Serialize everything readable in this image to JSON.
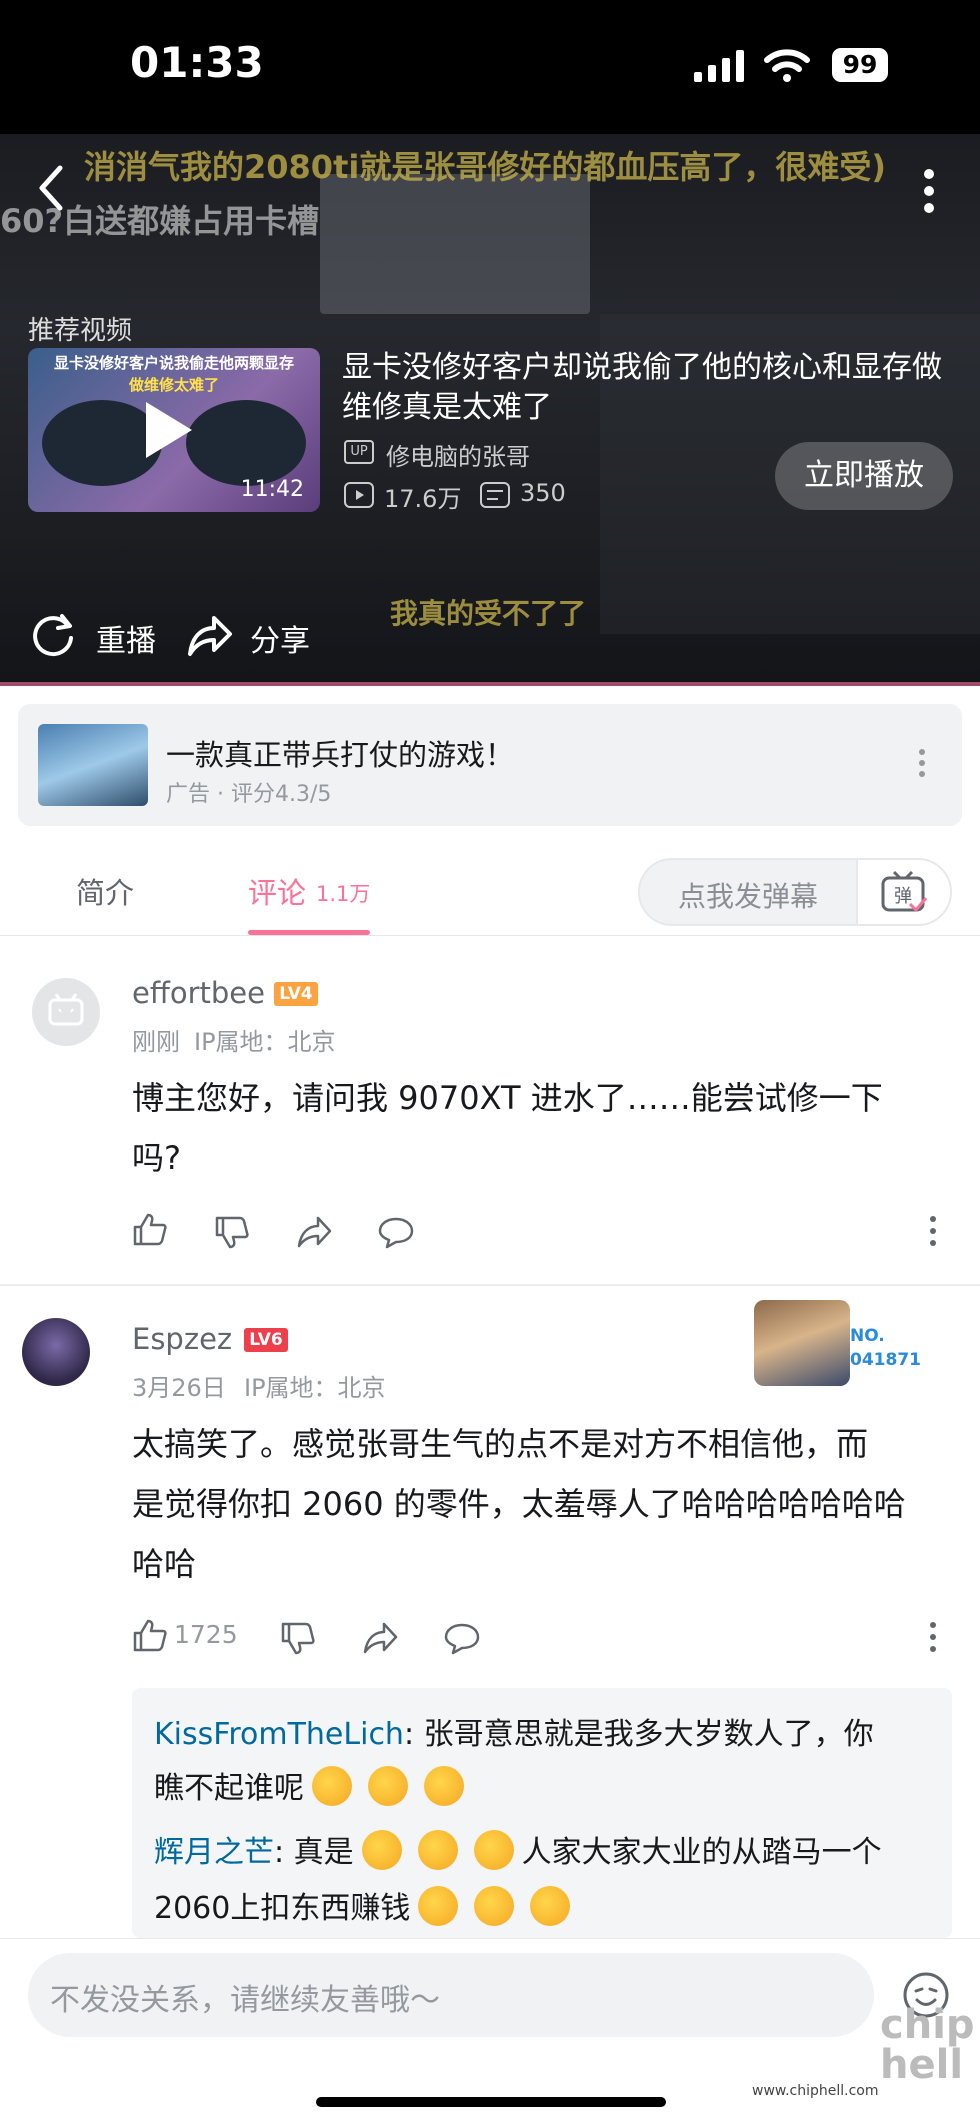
{
  "status_bar": {
    "time": "01:33",
    "battery": "99"
  },
  "video": {
    "subtitle_top": "消消气我的2080ti就是张哥修好的都血压高了，很难受)",
    "subtitle_second": "60?白送都嫌占用卡槽",
    "subtitle_bottom": "我真的受不了了",
    "recommend_label": "推荐视频",
    "recommended": {
      "thumb_line1": "显卡没修好客户说我偷走他两颗显存",
      "thumb_line2": "做维修太难了",
      "duration": "11:42",
      "title": "显卡没修好客户却说我偷了他的核心和显存做维修真是太难了",
      "uploader_badge": "UP",
      "uploader": "修电脑的张哥",
      "views": "17.6万",
      "danmaku_count": "350",
      "play_now": "立即播放"
    },
    "replay": "重播",
    "share": "分享"
  },
  "ad": {
    "title": "一款真正带兵打仗的游戏！",
    "meta": "广告 · 评分4.3/5"
  },
  "tabs": {
    "intro": "简介",
    "comments": "评论",
    "comments_count": "1.1万",
    "danmaku_placeholder": "点我发弹幕",
    "danmaku_icon_text": "弹"
  },
  "comments": [
    {
      "user": "effortbee",
      "level": "LV4",
      "time": "刚刚",
      "ip": "IP属地：北京",
      "text_line1": "博主您好，请问我 9070XT 进水了……能尝试修一下",
      "text_line2": "吗?"
    },
    {
      "user": "Espzez",
      "level": "LV6",
      "time": "3月26日",
      "ip": "IP属地：北京",
      "badge_no": "NO.",
      "badge_num": "041871",
      "text_line1": "太搞笑了。感觉张哥生气的点不是对方不相信他，而",
      "text_line2": "是觉得你扣 2060 的零件，太羞辱人了哈哈哈哈哈哈哈",
      "text_line3": "哈哈",
      "likes": "1725"
    }
  ],
  "replies": [
    {
      "user": "KissFromTheLich",
      "text_a": "张哥意思就是我多大岁数人了，你",
      "text_b": "瞧不起谁呢"
    },
    {
      "user": "辉月之芒",
      "text_a": "真是",
      "text_b": "人家大家大业的从踏马一个",
      "text_c": "2060上扣东西赚钱"
    }
  ],
  "input": {
    "placeholder": "不发没关系，请继续友善哦～"
  },
  "watermark": {
    "site": "www.chiphell.com",
    "logo": "chip hell"
  }
}
